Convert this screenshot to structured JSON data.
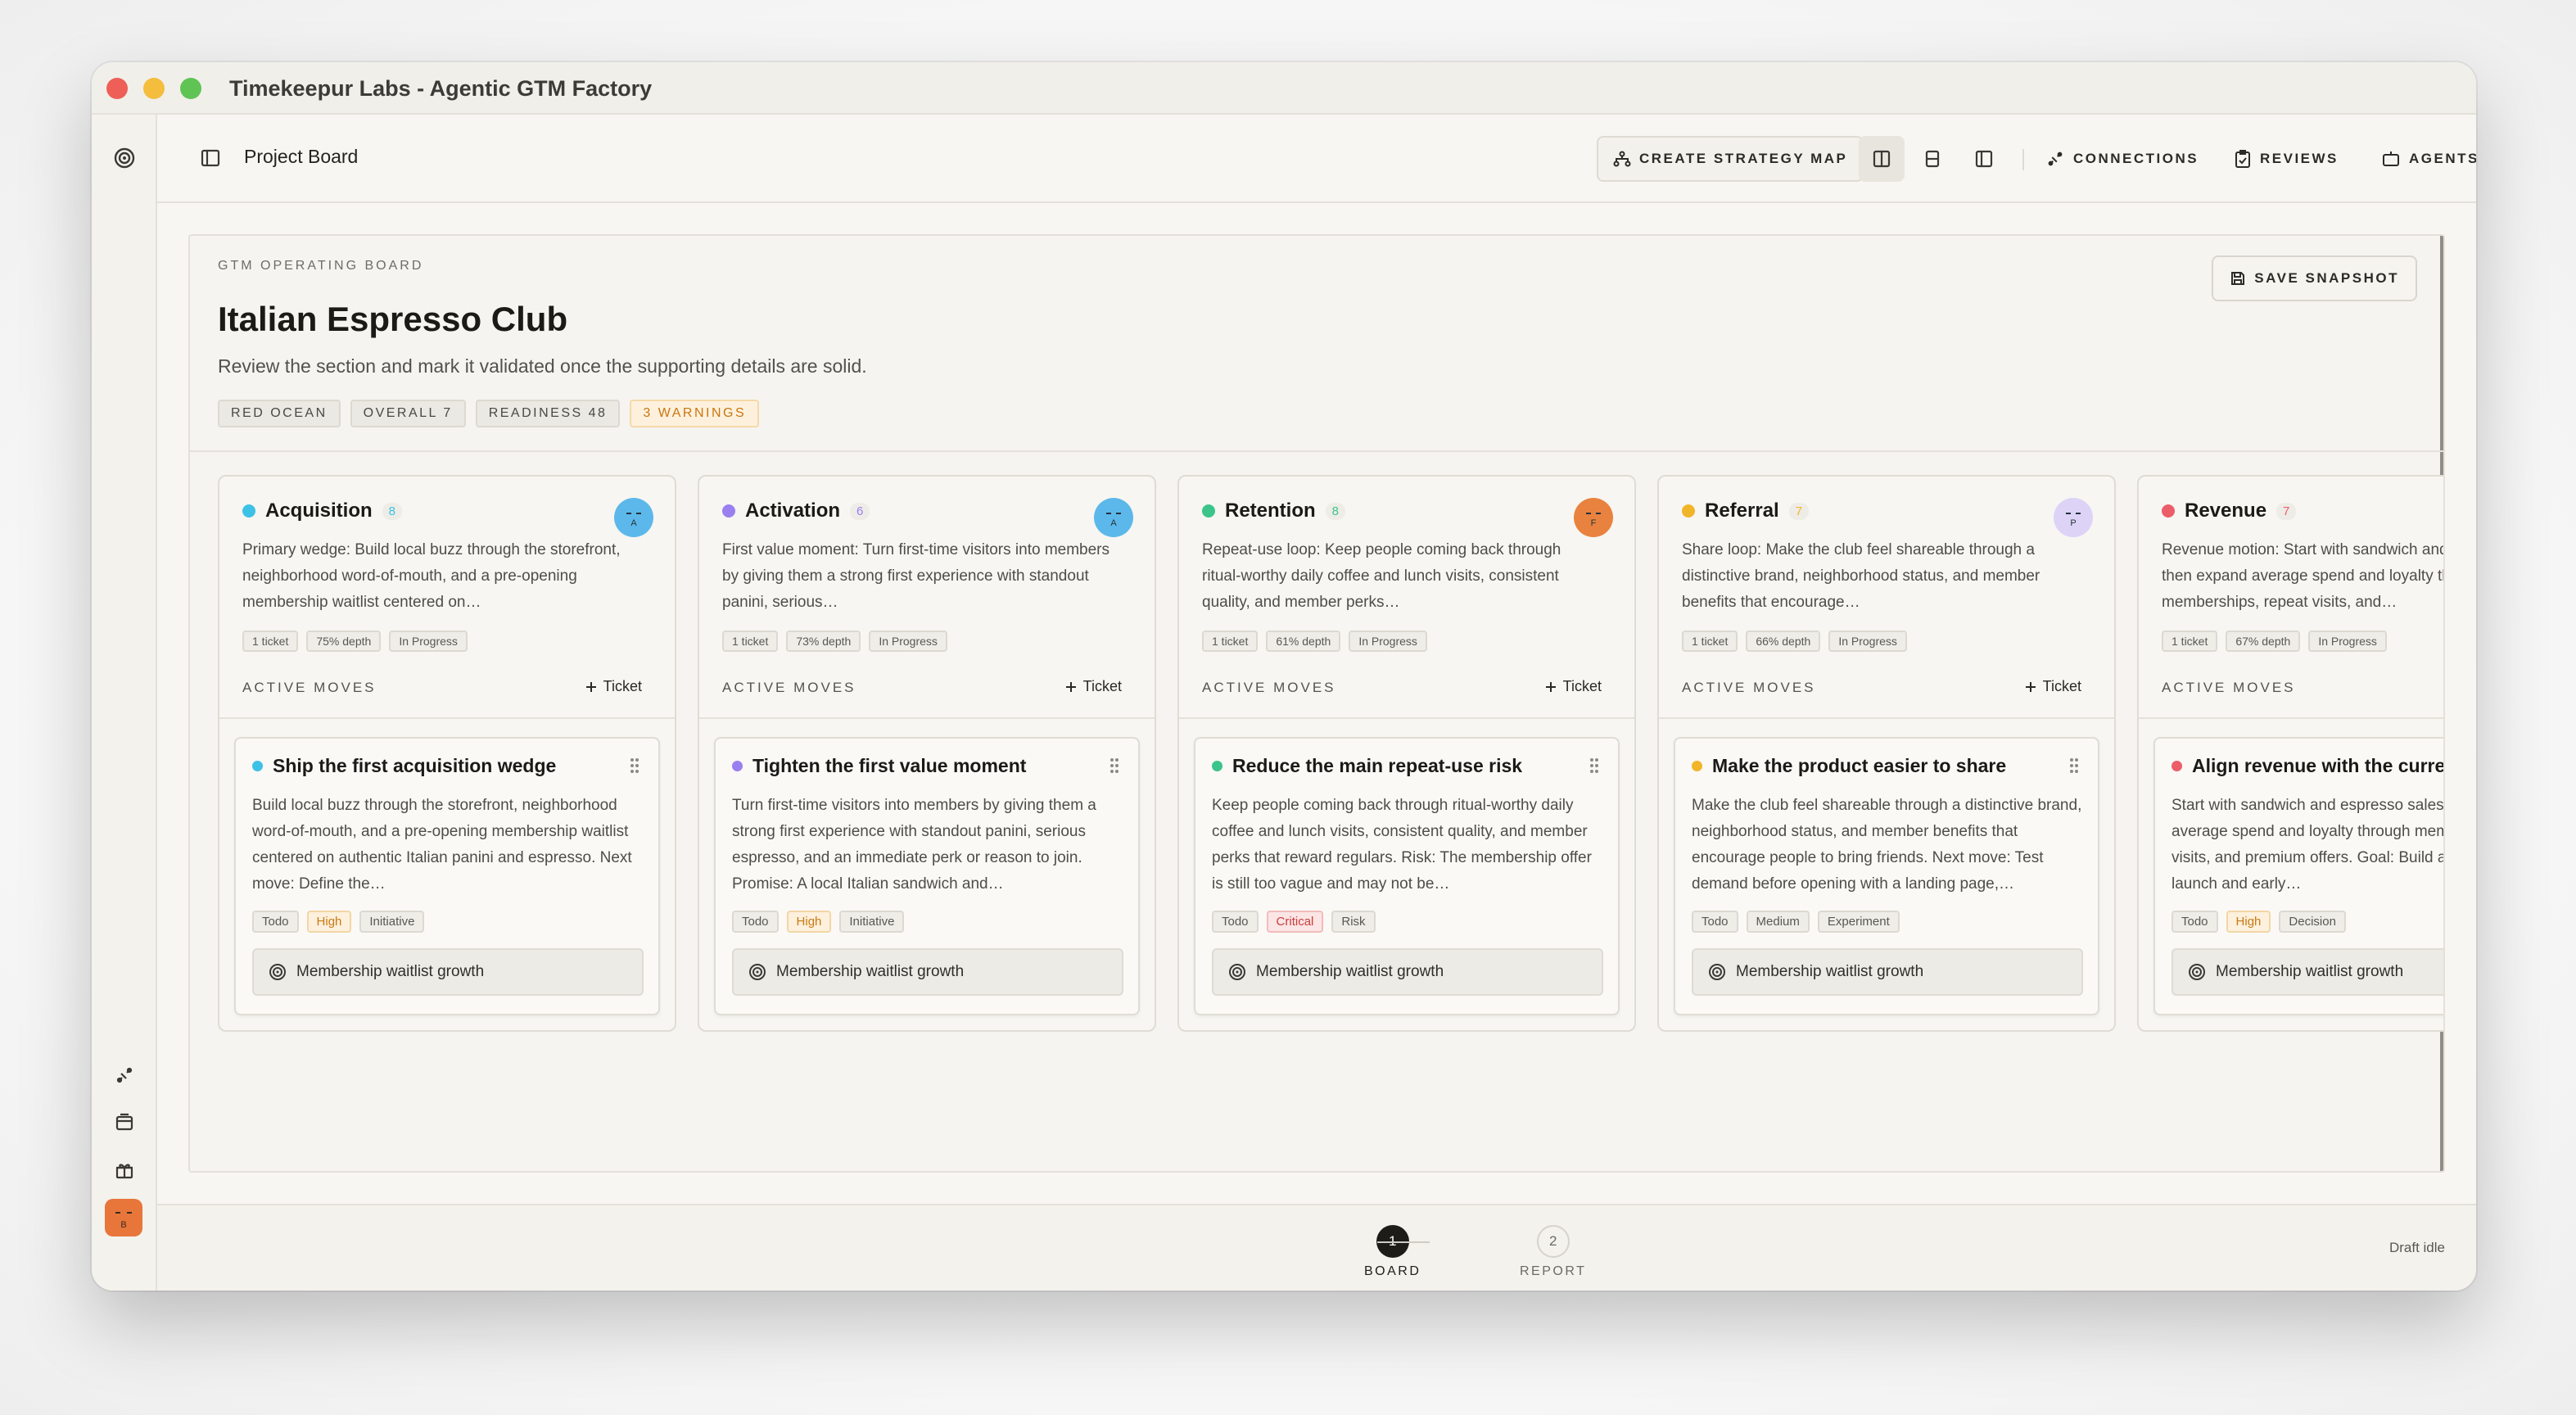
{
  "window": {
    "title": "Timekeepur Labs - Agentic GTM Factory"
  },
  "topbar": {
    "breadcrumb": "Project Board",
    "create_strategy_map": "CREATE STRATEGY MAP",
    "connections": "CONNECTIONS",
    "reviews": "REVIEWS",
    "agents": "AGENTS"
  },
  "board": {
    "eyebrow": "GTM OPERATING BOARD",
    "title": "Italian Espresso Club",
    "subtitle": "Review the section and mark it validated once the supporting details are solid.",
    "save_snapshot": "SAVE SNAPSHOT",
    "badges": [
      "RED OCEAN",
      "OVERALL 7",
      "READINESS 48",
      "3 WARNINGS"
    ],
    "active_moves_label": "ACTIVE MOVES",
    "add_ticket_label": "Ticket",
    "lanes": [
      {
        "name": "Acquisition",
        "count": "8",
        "color": "#3ec1e6",
        "avatar_letter": "A",
        "avatar_color": "#5cb8ea",
        "description": "Primary wedge: Build local buzz through the storefront, neighborhood word-of-mouth, and a pre-opening membership waitlist centered on…",
        "chips": [
          "1 ticket",
          "75% depth",
          "In Progress"
        ],
        "ticket": {
          "title": "Ship the first acquisition wedge",
          "color": "#3ec1e6",
          "description": "Build local buzz through the storefront, neighborhood word-of-mouth, and a pre-opening membership waitlist centered on authentic Italian panini and espresso. Next move: Define the…",
          "tags": [
            "Todo",
            "High",
            "Initiative"
          ],
          "goal": "Membership waitlist growth"
        }
      },
      {
        "name": "Activation",
        "count": "6",
        "color": "#9a7ff0",
        "avatar_letter": "A",
        "avatar_color": "#5cb8ea",
        "description": "First value moment: Turn first-time visitors into members by giving them a strong first experience with standout panini, serious…",
        "chips": [
          "1 ticket",
          "73% depth",
          "In Progress"
        ],
        "ticket": {
          "title": "Tighten the first value moment",
          "color": "#9a7ff0",
          "description": "Turn first-time visitors into members by giving them a strong first experience with standout panini, serious espresso, and an immediate perk or reason to join. Promise: A local Italian sandwich and…",
          "tags": [
            "Todo",
            "High",
            "Initiative"
          ],
          "goal": "Membership waitlist growth"
        }
      },
      {
        "name": "Retention",
        "count": "8",
        "color": "#3cc48a",
        "avatar_letter": "F",
        "avatar_color": "#e9823f",
        "description": "Repeat-use loop: Keep people coming back through ritual-worthy daily coffee and lunch visits, consistent quality, and member perks…",
        "chips": [
          "1 ticket",
          "61% depth",
          "In Progress"
        ],
        "ticket": {
          "title": "Reduce the main repeat-use risk",
          "color": "#3cc48a",
          "description": "Keep people coming back through ritual-worthy daily coffee and lunch visits, consistent quality, and member perks that reward regulars. Risk: The membership offer is still too vague and may not be…",
          "tags": [
            "Todo",
            "Critical",
            "Risk"
          ],
          "goal": "Membership waitlist growth"
        }
      },
      {
        "name": "Referral",
        "count": "7",
        "color": "#f1b52a",
        "avatar_letter": "P",
        "avatar_color": "#ddd3f7",
        "description": "Share loop: Make the club feel shareable through a distinctive brand, neighborhood status, and member benefits that encourage…",
        "chips": [
          "1 ticket",
          "66% depth",
          "In Progress"
        ],
        "ticket": {
          "title": "Make the product easier to share",
          "color": "#f1b52a",
          "description": "Make the club feel shareable through a distinctive brand, neighborhood status, and member benefits that encourage people to bring friends. Next move: Test demand before opening with a landing page,…",
          "tags": [
            "Todo",
            "Medium",
            "Experiment"
          ],
          "goal": "Membership waitlist growth"
        }
      },
      {
        "name": "Revenue",
        "count": "7",
        "color": "#ec5d6a",
        "avatar_letter": "",
        "avatar_color": "#f7f6f2",
        "description": "Revenue motion: Start with sandwich and espresso sales, then expand average spend and loyalty through memberships, repeat visits, and…",
        "chips": [
          "1 ticket",
          "67% depth",
          "In Progress"
        ],
        "ticket": {
          "title": "Align revenue with the current motion",
          "color": "#ec5d6a",
          "description": "Start with sandwich and espresso sales, then expand average spend and loyalty through memberships, repeat visits, and premium offers. Goal: Build a strong pre-launch and early…",
          "tags": [
            "Todo",
            "High",
            "Decision"
          ],
          "goal": "Membership waitlist growth"
        }
      }
    ]
  },
  "footer": {
    "steps": [
      {
        "number": "1",
        "label": "BOARD"
      },
      {
        "number": "2",
        "label": "REPORT"
      }
    ],
    "status": "Draft idle"
  },
  "sidebar": {
    "user_avatar_letter": "B"
  }
}
